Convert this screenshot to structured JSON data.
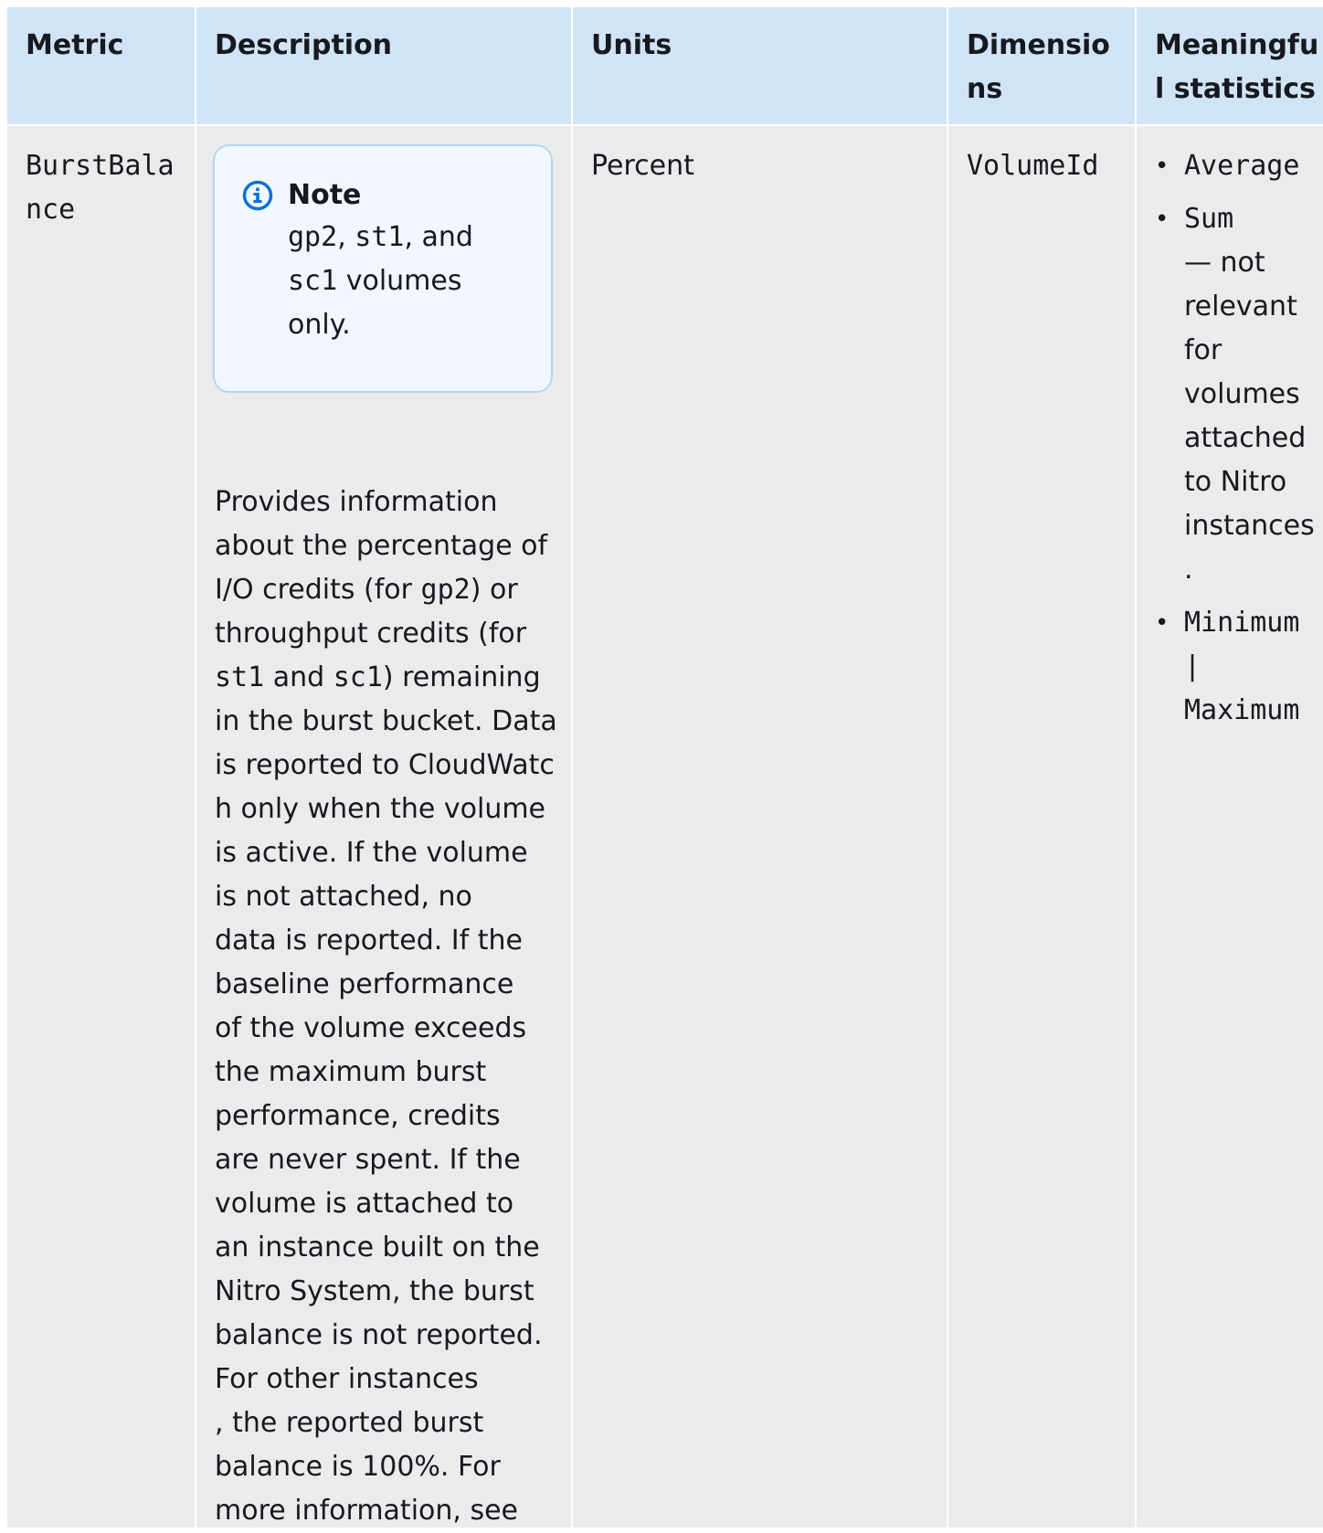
{
  "table": {
    "headers": {
      "metric": "Metric",
      "description": "Description",
      "units": "Units",
      "dimensions": "Dimensions",
      "statistics": "Meaningful statistics"
    },
    "row": {
      "metric": "BurstBalance",
      "note": {
        "title": "Note",
        "body_lines": [
          "gp2, st1, and",
          "sc1 volumes",
          "only."
        ]
      },
      "description_lines": [
        "Provides information",
        "about the percentage of",
        "I/O credits (for gp2) or",
        "throughput credits (for",
        "st1 and sc1) remaining",
        "in the burst bucket. Data",
        "is reported to CloudWatc",
        "h only when the volume",
        "is active. If the volume",
        "is not attached, no",
        "data is reported. If the",
        "baseline performance",
        "of the volume exceeds",
        "the maximum burst",
        "performance, credits",
        "are never spent. If the",
        "volume is attached to",
        "an instance built on the",
        "Nitro System, the burst",
        "balance is not reported.",
        "For other instances",
        ", the reported burst",
        "balance is 100%. For",
        "more information, see"
      ],
      "units": "Percent",
      "dimensions": "VolumeId",
      "statistics": [
        {
          "lines": [
            "Average"
          ]
        },
        {
          "lines": [
            "Sum",
            "— not",
            "relevant",
            "for",
            "volumes",
            "attached",
            "to Nitro",
            "instances",
            "."
          ]
        },
        {
          "lines": [
            "Minimum",
            "|",
            "Maximum"
          ]
        }
      ]
    }
  },
  "colors": {
    "header_bg": "#d1e4f6",
    "body_bg": "#ebebeb",
    "note_bg": "#f1f7fd",
    "note_border": "#b5d4f2",
    "info_icon": "#0972d3"
  },
  "icons": {
    "note": "info-icon"
  }
}
